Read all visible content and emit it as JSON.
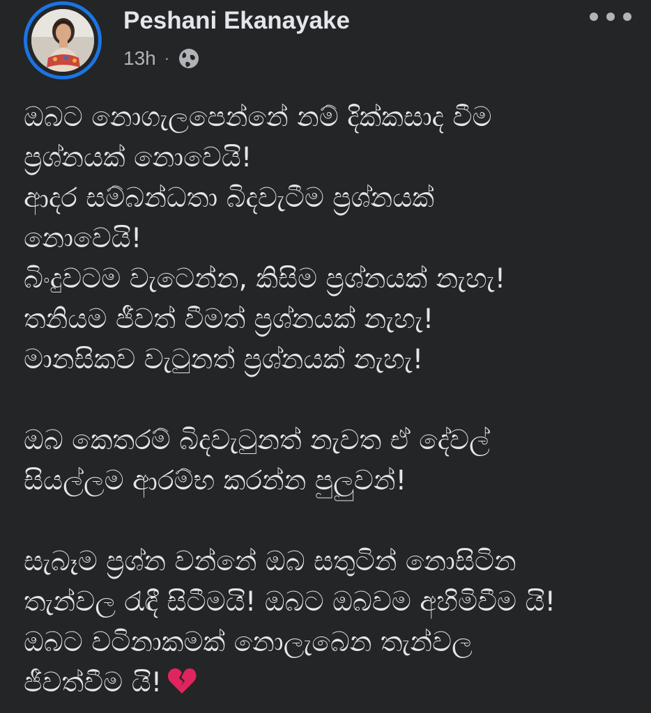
{
  "post": {
    "author": "Peshani Ekanayake",
    "time": "13h",
    "separator": "·",
    "audience_icon": "globe-icon",
    "more_icon": "more-horizontal-icon",
    "lines_block1": [
      "ඔබට නොගැලපෙන්නේ නම් දික්කසාද වීම",
      "ප්‍රශ්නයක් නොවෙයි!",
      "ආදර සම්බන්ධතා බිදවැටීම ප්‍රශ්නයක්",
      "නොවෙයි!",
      "බිංදුවටම වැටෙන්න, කිසිම ප්‍රශ්නයක් නැහැ!",
      "තනියම ජීවත් වීමත් ප්‍රශ්නයක් නැහැ!",
      "මානසිකව වැටුනත් ප්‍රශ්නයක් නැහැ!"
    ],
    "lines_block2": [
      "ඔබ කෙතරම් බිදවැටුනත් නැවත ඒ දේවල්",
      "සියල්ලම ආරම්භ කරන්න පුලුවන්!"
    ],
    "lines_block3": [
      "සැබෑම ප්‍රශ්න වන්නේ ඔබ සතුටින් නොසිටින",
      "තැන්වල රැඳී සිටීමයි! ඔබට ඔබවම අහිමිවීම යි!",
      "ඔබට වටිනාකමක් නොලැබෙන තැන්වල",
      "ජීවත්වීම යි!"
    ],
    "end_emoji": "broken-heart-icon"
  },
  "colors": {
    "background": "#242526",
    "text_primary": "#e4e6eb",
    "text_secondary": "#b0b3b8",
    "story_ring": "#1b74e4",
    "broken_heart": "#e0245e"
  }
}
